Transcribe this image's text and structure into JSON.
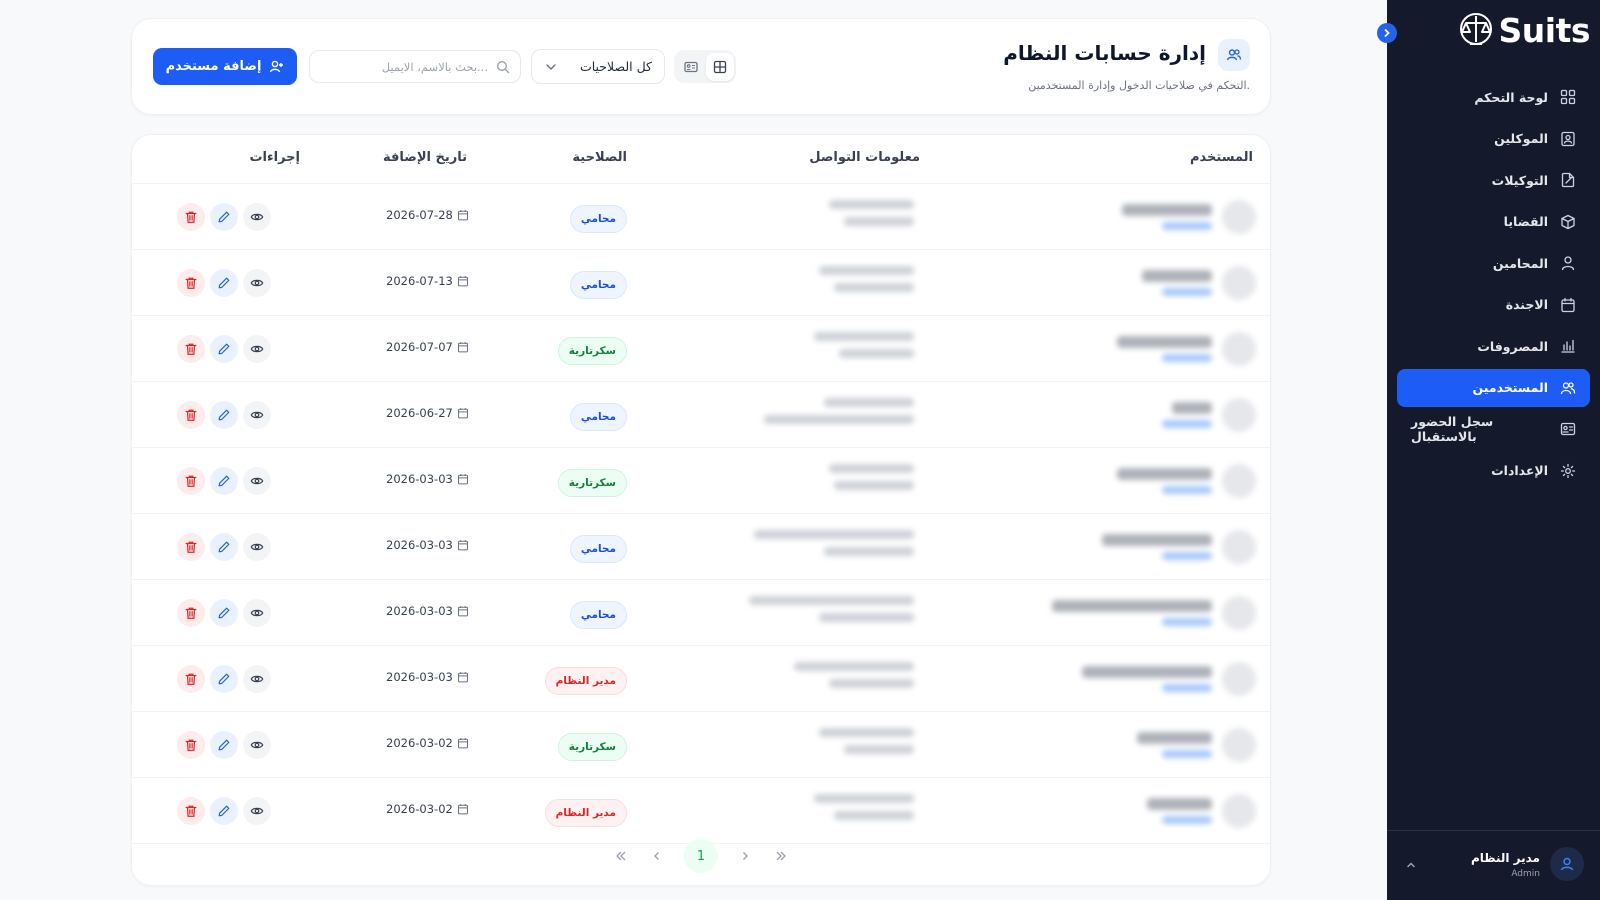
{
  "app": {
    "brand": "Suits"
  },
  "sidebar": {
    "items": [
      {
        "label": "لوحة التحكم",
        "icon": "dashboard-icon"
      },
      {
        "label": "الموكلين",
        "icon": "clients-icon"
      },
      {
        "label": "التوكيلات",
        "icon": "power-of-attorney-icon"
      },
      {
        "label": "القضايا",
        "icon": "cases-icon"
      },
      {
        "label": "المحامين",
        "icon": "lawyers-icon"
      },
      {
        "label": "الاجندة",
        "icon": "calendar-icon"
      },
      {
        "label": "المصروفات",
        "icon": "expenses-icon"
      },
      {
        "label": "المستخدمين",
        "icon": "users-icon",
        "active": true
      },
      {
        "label": "سجل الحضور بالاستقبال",
        "icon": "attendance-icon"
      },
      {
        "label": "الإعدادات",
        "icon": "settings-icon"
      }
    ],
    "user": {
      "name": "مدير النظام",
      "role": "Admin"
    }
  },
  "header": {
    "title": "إدارة حسابات النظام",
    "subtitle": "التحكم في صلاحيات الدخول وإدارة المستخدمين.",
    "add_button": "إضافة مستخدم",
    "search_placeholder": "بحث بالاسم، الايميل...",
    "role_filter": "كل الصلاحيات",
    "view_mode": "table"
  },
  "table": {
    "columns": {
      "user": "المستخدم",
      "contact": "معلومات التواصل",
      "role": "الصلاحية",
      "date": "تاريخ الإضافة",
      "actions": "إجراءات"
    },
    "rows": [
      {
        "role": "محامي",
        "role_type": "lawyer",
        "date": "2026-07-28"
      },
      {
        "role": "محامي",
        "role_type": "lawyer",
        "date": "2026-07-13"
      },
      {
        "role": "سكرتارية",
        "role_type": "secretary",
        "date": "2026-07-07"
      },
      {
        "role": "محامي",
        "role_type": "lawyer",
        "date": "2026-06-27"
      },
      {
        "role": "سكرتارية",
        "role_type": "secretary",
        "date": "2026-03-03"
      },
      {
        "role": "محامي",
        "role_type": "lawyer",
        "date": "2026-03-03"
      },
      {
        "role": "محامي",
        "role_type": "lawyer",
        "date": "2026-03-03"
      },
      {
        "role": "مدير النظام",
        "role_type": "admin",
        "date": "2026-03-03"
      },
      {
        "role": "سكرتارية",
        "role_type": "secretary",
        "date": "2026-03-02"
      },
      {
        "role": "مدير النظام",
        "role_type": "admin",
        "date": "2026-03-02"
      }
    ]
  },
  "pagination": {
    "current_page": "1"
  },
  "colors": {
    "primary": "#1d5cf5",
    "sidebar_bg": "#141a2b",
    "lawyer": "#1d4ed8",
    "secretary": "#15803d",
    "admin": "#dc2626"
  }
}
